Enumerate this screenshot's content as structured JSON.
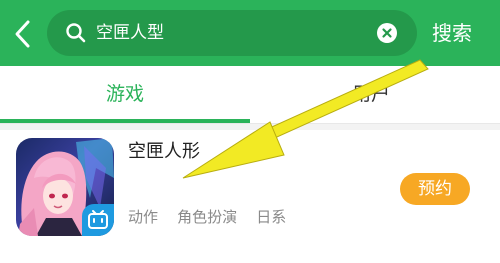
{
  "header": {
    "search_query": "空匣人型",
    "search_button_label": "搜索"
  },
  "tabs": [
    {
      "label": "游戏",
      "active": true
    },
    {
      "label": "用户",
      "active": false
    }
  ],
  "results": [
    {
      "title": "空匣人形",
      "tags": [
        "动作",
        "角色扮演",
        "日系"
      ],
      "action_label": "预约"
    }
  ],
  "colors": {
    "brand_green": "#2bb35a",
    "search_box": "#24994b",
    "reserve_orange": "#f7a824",
    "annotation_arrow": "#f2ea24"
  },
  "icons": [
    "back-arrow-icon",
    "search-icon",
    "clear-icon",
    "bilibili-badge-icon"
  ]
}
